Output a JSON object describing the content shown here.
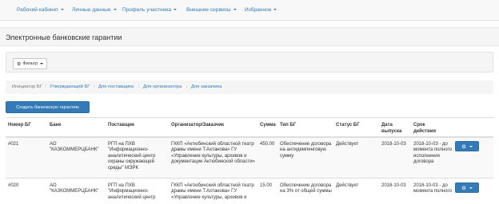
{
  "nav": {
    "items": [
      {
        "label": "Рабочий кабинет"
      },
      {
        "label": "Личные данные"
      },
      {
        "label": "Профиль участника"
      },
      {
        "label": "Внешние сервисы"
      },
      {
        "label": "Избранное"
      }
    ]
  },
  "page": {
    "title": "Электронные банковские гарантии"
  },
  "filter": {
    "label": "Фильтр"
  },
  "breadcrumbs": [
    {
      "label": "Инициатор БГ"
    },
    {
      "label": "Утверждающий БГ"
    },
    {
      "label": "Для поставщика"
    },
    {
      "label": "Для организатора"
    },
    {
      "label": "Для заказчика"
    }
  ],
  "create_button": {
    "label": "Создать банковскую гарантию"
  },
  "table": {
    "headers": {
      "number": "Номер БГ",
      "bank": "Банк",
      "supplier": "Поставщик",
      "organizer": "Организатор/Заказчик",
      "sum": "Сумма",
      "type": "Тип БГ",
      "status": "Статус БГ",
      "issue_date": "Дата выпуска",
      "validity": "Срок действия"
    },
    "rows": [
      {
        "number": "#021",
        "bank": "АО \"КАЗКОММЕРЦБАНК\"",
        "supplier": "РГП на ПХВ \"Информационно-аналитический центр охраны окружающей среды\" МЭРК",
        "organizer": "ГККП «Актюбинский областной театр драмы имени Т.Ахтанова» ГУ «Управление культуры, архивов и документации Актюбинской области»",
        "sum": "450.00",
        "type": "Обеспечение договора на антидемпинговую сумму",
        "status": "Действует",
        "issue_date": "2018-10-03",
        "validity": "2018-10-03 - до момента полного исполнения договора"
      },
      {
        "number": "#020",
        "bank": "АО \"КАЗКОММЕРЦБАНК\"",
        "supplier": "РГП на ПХВ \"Информационно-аналитический центр",
        "organizer": "ГККП «Актюбинский областной театр драмы имени Т.Ахтанова» ГУ «Управление культуры, архивов и",
        "sum": "15.00",
        "type": "Обеспечение договора на 3% от общей суммы",
        "status": "Действует",
        "issue_date": "2018-10-03",
        "validity": "2018-10-03 - до момента полного"
      }
    ]
  },
  "icons": {
    "actions": "gear-icon",
    "filter": "gear-icon"
  },
  "colors": {
    "primary": "#337ab7",
    "link": "#337ab7"
  }
}
